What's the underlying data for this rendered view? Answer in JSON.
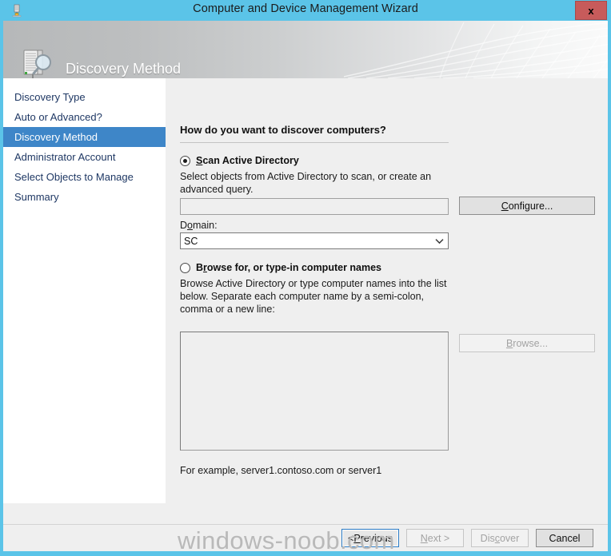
{
  "window": {
    "title": "Computer and Device Management Wizard",
    "close_label": "x",
    "titlebar_icon": "server-icon",
    "accent_color": "#5bc4e8"
  },
  "banner": {
    "title": "Discovery Method",
    "icon": "server-discovery-icon"
  },
  "sidebar": {
    "items": [
      {
        "label": "Discovery Type",
        "selected": false
      },
      {
        "label": "Auto or Advanced?",
        "selected": false
      },
      {
        "label": "Discovery Method",
        "selected": true
      },
      {
        "label": "Administrator Account",
        "selected": false
      },
      {
        "label": "Select Objects to Manage",
        "selected": false
      },
      {
        "label": "Summary",
        "selected": false
      }
    ],
    "selected_color": "#3e86c8",
    "text_color": "#1f3864"
  },
  "main": {
    "heading": "How do you want to discover computers?",
    "option_scan_ad": {
      "label_pre": "",
      "label_acc": "S",
      "label_post": "can Active Directory",
      "selected": true,
      "description": "Select objects from Active Directory to scan, or create an advanced query.",
      "query_value": "",
      "query_placeholder": "",
      "domain_label_pre": "D",
      "domain_label_acc": "o",
      "domain_label_post": "main:",
      "domain_value": "SC",
      "configure_label_pre": "",
      "configure_label_acc": "C",
      "configure_label_post": "onfigure...",
      "configure_enabled": true
    },
    "option_browse": {
      "label_pre": "B",
      "label_acc": "r",
      "label_post": "owse for, or type-in computer names",
      "selected": false,
      "description": "Browse Active Directory or type computer names into the list below. Separate each computer name by a semi-colon, comma or a new line:",
      "names_value": "",
      "browse_label_pre": "",
      "browse_label_acc": "B",
      "browse_label_post": "rowse...",
      "browse_enabled": false
    },
    "example_text": "For example, server1.contoso.com or server1"
  },
  "footer": {
    "buttons": [
      {
        "pre": "< ",
        "acc": "P",
        "post": "revious",
        "enabled": true,
        "focused": true
      },
      {
        "pre": "",
        "acc": "N",
        "post": "ext >",
        "enabled": false,
        "focused": false
      },
      {
        "pre": "Dis",
        "acc": "c",
        "post": "over",
        "enabled": false,
        "focused": false
      },
      {
        "pre": "Cancel",
        "acc": "",
        "post": "",
        "enabled": true,
        "focused": false
      }
    ]
  },
  "watermark": {
    "text": "windows-noob.com"
  }
}
